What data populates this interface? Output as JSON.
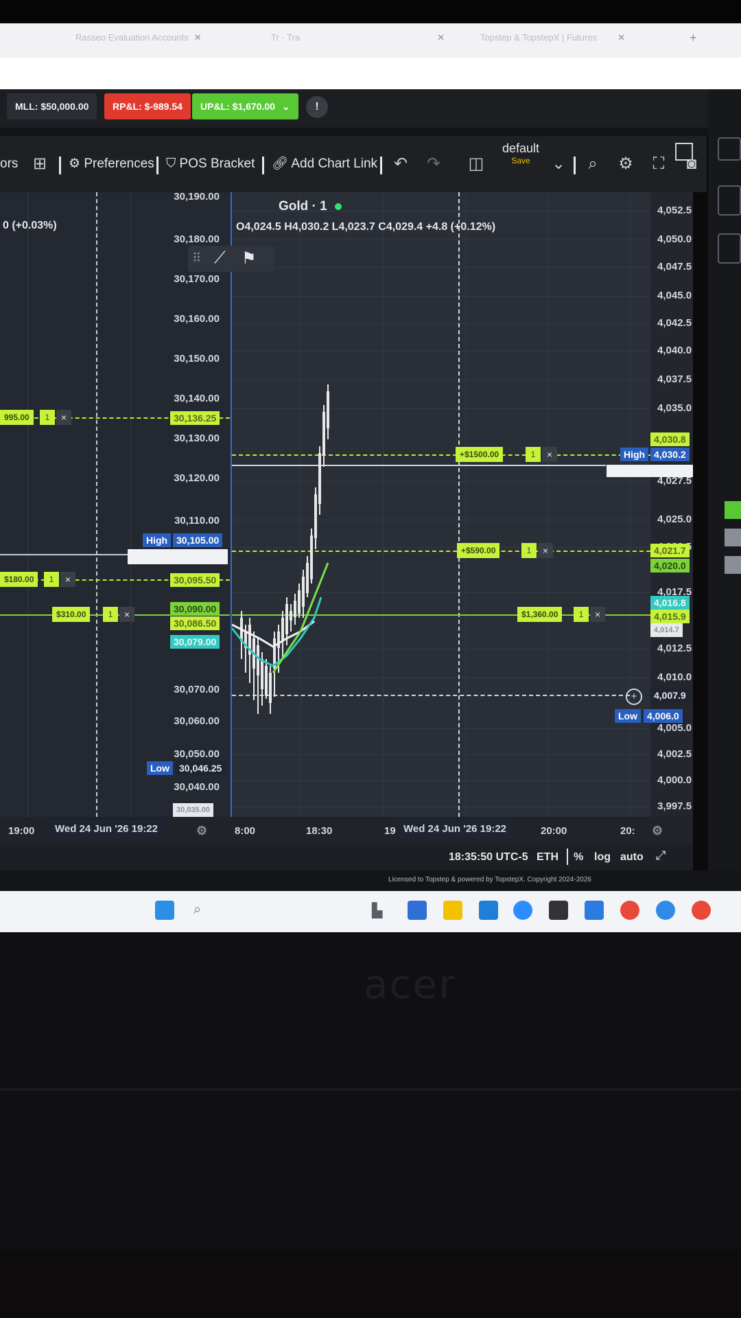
{
  "browser": {
    "tabs": [
      {
        "label": "Rasseo Evaluation Accounts"
      },
      {
        "label": "Tr · Tra"
      },
      {
        "label": "Topstep & TopstepX | Futures"
      }
    ],
    "new_tab": "+"
  },
  "account_bar": {
    "mll": "MLL: $50,000.00",
    "rpnl": "RP&L: $-989.54",
    "upnl": "UP&L: $1,670.00",
    "info": "!"
  },
  "toolbar": {
    "indicators_label": "ors",
    "preferences_label": "Preferences",
    "pos_bracket_label": "POS Bracket",
    "add_chart_link_label": "Add Chart Link",
    "layout_name": "default",
    "layout_save": "Save"
  },
  "left_chart": {
    "ohlc_fragment": "0 (+0.03%)",
    "y_ticks": [
      "30,190.00",
      "30,180.00",
      "30,170.00",
      "30,160.00",
      "30,150.00",
      "30,140.00",
      "30,130.00",
      "30,120.00",
      "30,110.00",
      "30,070.00",
      "30,060.00",
      "30,050.00",
      "30,040.00"
    ],
    "high_label": "High",
    "high_value": "30,105.00",
    "low_label": "Low",
    "low_value": "30,046.25",
    "order_tags": [
      {
        "text": "995.00",
        "q": "1",
        "x": "×"
      },
      {
        "text": "$180.00",
        "q": "1",
        "x": "×"
      },
      {
        "text": "$310.00",
        "q": "1",
        "x": "×"
      }
    ],
    "axis_flags": [
      "30,136.25",
      "30,095.50",
      "30,090.00",
      "30,086.50",
      "30,079.00",
      "30,035.00"
    ],
    "time_label": "19:00",
    "crosshair_time": "Wed 24 Jun '26  19:22"
  },
  "main_chart": {
    "symbol": "Gold · 1",
    "ohlc": "O4,024.5 H4,030.2 L4,023.7 C4,029.4 +4.8 (+0.12%)",
    "y_ticks": [
      "4,052.5",
      "4,050.0",
      "4,047.5",
      "4,045.0",
      "4,042.5",
      "4,040.0",
      "4,037.5",
      "4,035.0",
      "4,027.5",
      "4,025.0",
      "4,022.5",
      "4,017.5",
      "4,012.5",
      "4,010.0",
      "4,005.0",
      "4,002.5",
      "4,000.0",
      "3,997.5"
    ],
    "high_label": "High",
    "high_value": "4,030.2",
    "low_label": "Low",
    "low_value": "4,006.0",
    "crosshair_price": "4,007.9",
    "axis_flags": [
      "4,030.8",
      "4,021.7",
      "4,020.0",
      "4,016.8",
      "4,015.9",
      "4,014.7"
    ],
    "order_tags": [
      {
        "text": "+$1500.00",
        "q": "1",
        "x": "×"
      },
      {
        "text": "+$590.00",
        "q": "1",
        "x": "×"
      },
      {
        "text": "$1,360.00",
        "q": "1",
        "x": "×"
      }
    ],
    "x_ticks": [
      "8:00",
      "18:30",
      "19:",
      "20:00",
      "20:"
    ],
    "crosshair_time": "Wed 24 Jun '26  19:22"
  },
  "status_bar": {
    "clock": "18:35:50 UTC-5",
    "session": "ETH",
    "percent": "%",
    "log": "log",
    "auto": "auto"
  },
  "copyright": "Licensed to Topstep & powered by TopstepX. Copyright 2024-2026",
  "brand": "acer",
  "colors": {
    "rpnl": "#e03a2e",
    "upnl": "#58c934",
    "order_line": "#b5f02a",
    "position_line": "#7bd23a",
    "candle": "#e8e8e8",
    "high_flag": "#2b5fbf",
    "low_flag": "#2b5fbf",
    "ma_cyan": "#33c8c0",
    "ma_white": "#f0f0f0",
    "ma_green": "#7be04a"
  }
}
